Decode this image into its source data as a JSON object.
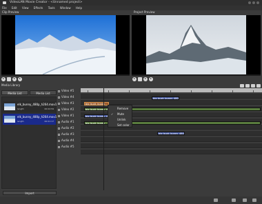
{
  "window": {
    "title": "VideoLAN Movie Creator - <Unnamed project>"
  },
  "menu": [
    "File",
    "Edit",
    "View",
    "Effects",
    "Tools",
    "Window",
    "Help"
  ],
  "clip_preview": {
    "title": "Clip Preview"
  },
  "project_preview": {
    "title": "Project Preview"
  },
  "media_library": {
    "title": "Media Library",
    "tabs": [
      "Media List",
      "Media List"
    ],
    "items": [
      {
        "name": "elk_bunny_480p_h264.mov1",
        "meta": "length",
        "duration": "00:02:59"
      },
      {
        "name": "elk_bunny_480p_h264.mov1",
        "meta": "length",
        "duration": "00:01:17"
      }
    ],
    "import_label": "Import"
  },
  "tracks": {
    "video": [
      "Video #5",
      "Video #4",
      "Video #3",
      "Video #2",
      "Video #1"
    ],
    "audio": [
      "Audio #1",
      "Audio #2",
      "Audio #3",
      "Audio #4",
      "Audio #5"
    ]
  },
  "clips": {
    "video_4": "big_buck_bunny_480p",
    "video_2": "big_buck_bunny",
    "video_1": "big_buck_bunny_480",
    "audio_1": "big_buck_bunny_480",
    "audio_2": "big_buck_bunny",
    "audio_4": "big_buck_bunny_480p"
  },
  "context_menu": {
    "items": [
      "Remove",
      "Mute",
      "Unlink",
      "Set color"
    ],
    "checked": "Mute"
  },
  "colors": {
    "selection": "#1a2a8c",
    "clip_blue": "#4c5fa6",
    "clip_orange": "#9a5a2e",
    "clip_green": "#5a7d3e"
  }
}
